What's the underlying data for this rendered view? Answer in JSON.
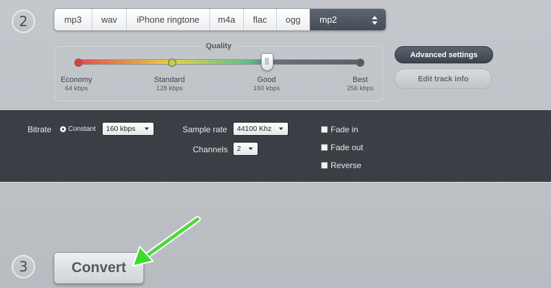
{
  "steps": {
    "format_step": "2",
    "convert_step": "3"
  },
  "formats": {
    "items": [
      "mp3",
      "wav",
      "iPhone ringtone",
      "m4a",
      "flac",
      "ogg",
      "mp2"
    ],
    "selected": "mp2"
  },
  "quality": {
    "title": "Quality",
    "selected_fraction": 0.67,
    "levels": [
      {
        "name": "Economy",
        "kbps": "64 kbps"
      },
      {
        "name": "Standard",
        "kbps": "128 kbps"
      },
      {
        "name": "Good",
        "kbps": "160 kbps"
      },
      {
        "name": "Best",
        "kbps": "256 kbps"
      }
    ]
  },
  "buttons": {
    "advanced": "Advanced settings",
    "edit_track": "Edit track info",
    "convert": "Convert"
  },
  "settings": {
    "bitrate_label": "Bitrate",
    "bitrate_mode": "Constant",
    "bitrate_value": "160 kbps",
    "sample_rate_label": "Sample rate",
    "sample_rate_value": "44100 Khz",
    "channels_label": "Channels",
    "channels_value": "2",
    "fade_in": "Fade in",
    "fade_out": "Fade out",
    "reverse": "Reverse"
  },
  "colors": {
    "active_format": "#4f5761",
    "dark_panel": "#3b3f45",
    "arrow": "#3ddc2a"
  }
}
